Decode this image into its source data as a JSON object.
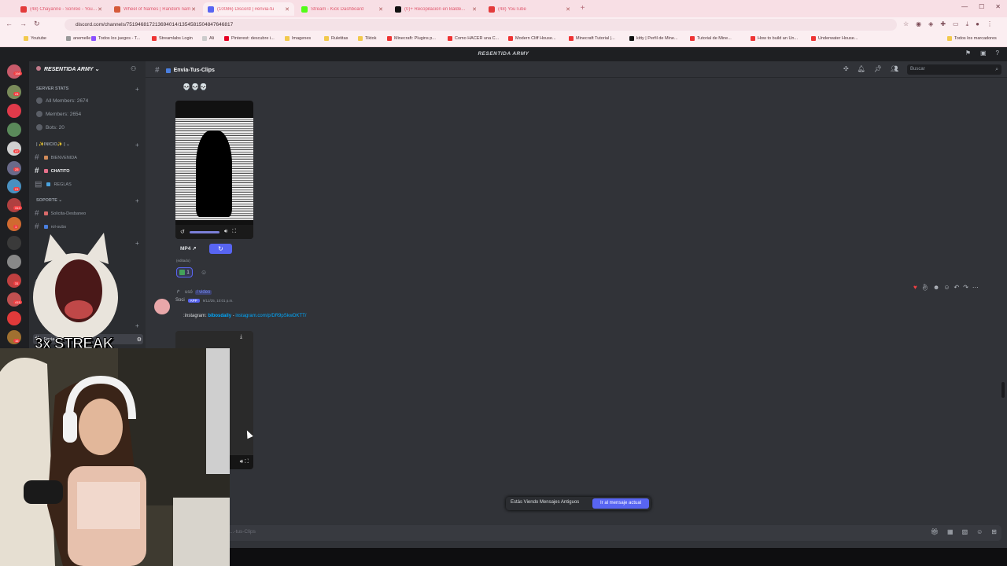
{
  "browser": {
    "tabs": [
      {
        "title": "(48) Chayanne - Sonreo - YouTu",
        "color": "#e33b3b",
        "active": false
      },
      {
        "title": "Wheel of Names | Random nam",
        "color": "#d55a3a",
        "active": false
      },
      {
        "title": "(10086) Discord | #envia-tu",
        "color": "#5865f2",
        "active": true
      },
      {
        "title": "Stream - Kick Dashboard",
        "color": "#53fc18",
        "active": false
      },
      {
        "title": "(0)+ Recopilación en Balde...",
        "color": "#111111",
        "active": false
      },
      {
        "title": "(48) YouTube",
        "color": "#e33b3b",
        "active": false
      }
    ],
    "url": "discord.com/channels/751946817213694014/1354581504847646817",
    "bookmarks": [
      "Youtube",
      "anemelle",
      "Todos los juegos - T...",
      "Streamlabs Login",
      "Ali",
      "Pinterest: descubre i...",
      "Imagenes",
      "Ruletitas",
      "Tiktok",
      "Minecraft: Plugins p...",
      "Como HACER una C...",
      "Modern Cliff House...",
      "Minecraft Tutorial |...",
      "kitty | Perfil de Mine...",
      "Tutorial de Mine...",
      "How to build an Un...",
      "Underwater House..."
    ],
    "bookmarks_other": "Todos los marcadores"
  },
  "app": {
    "window_title": "RESENTIDA ARMY"
  },
  "server": {
    "name": "RESENTIDA ARMY",
    "stats_category": "SERVER STATS",
    "stats": [
      "All Members: 2674",
      "Members: 2654",
      "Bots: 20"
    ],
    "categories": [
      {
        "name": "| ✨INICIO✨ |",
        "channels": [
          {
            "name": "bienvenida",
            "emoji_color": "#d28b5a",
            "active": false
          },
          {
            "name": "chatito",
            "emoji_color": "#e6708a",
            "active": true
          },
          {
            "name": "reglas",
            "emoji_color": "#4aa3df",
            "active": false
          }
        ]
      },
      {
        "name": "SOPORTE",
        "channels": [
          {
            "name": "solicita-desbaneo",
            "emoji_color": "#d96a6a",
            "active": false
          },
          {
            "name": "rol-subs",
            "emoji_color": "#4a7fdf",
            "active": false
          }
        ]
      }
    ],
    "selected_channel": "envia-tus-clips",
    "guild_badges": [
      "198",
      "24",
      "97",
      "25",
      "21",
      "313",
      "1",
      "31",
      "415",
      "16"
    ]
  },
  "channel_header": {
    "name": "envia-tus-clips",
    "search_placeholder": "Buscar"
  },
  "messages": {
    "first": {
      "emojis": "💀💀💀",
      "video_format": "MP4",
      "edited": "(editado)",
      "reaction_count": "1"
    },
    "second": {
      "reply_user": "",
      "reply_text": "usó",
      "reply_command": "/ video",
      "author": "Soci",
      "app_badge": "APP",
      "timestamp": "9/12/25, 10:01 p.m.",
      "text_prefix": ":instagram:",
      "text_user": "bibosdaily",
      "text_sep": " - ",
      "text_link": "instagram.com/p/DR9pSkwDKTT/"
    }
  },
  "notice": {
    "label": "Estás Viendo Mensajes Antiguos",
    "button": "Ir al mensaje actual"
  },
  "composer": {
    "placeholder": "...-tus-Clips"
  },
  "overlay": {
    "streak_text": "3x STREAK"
  }
}
